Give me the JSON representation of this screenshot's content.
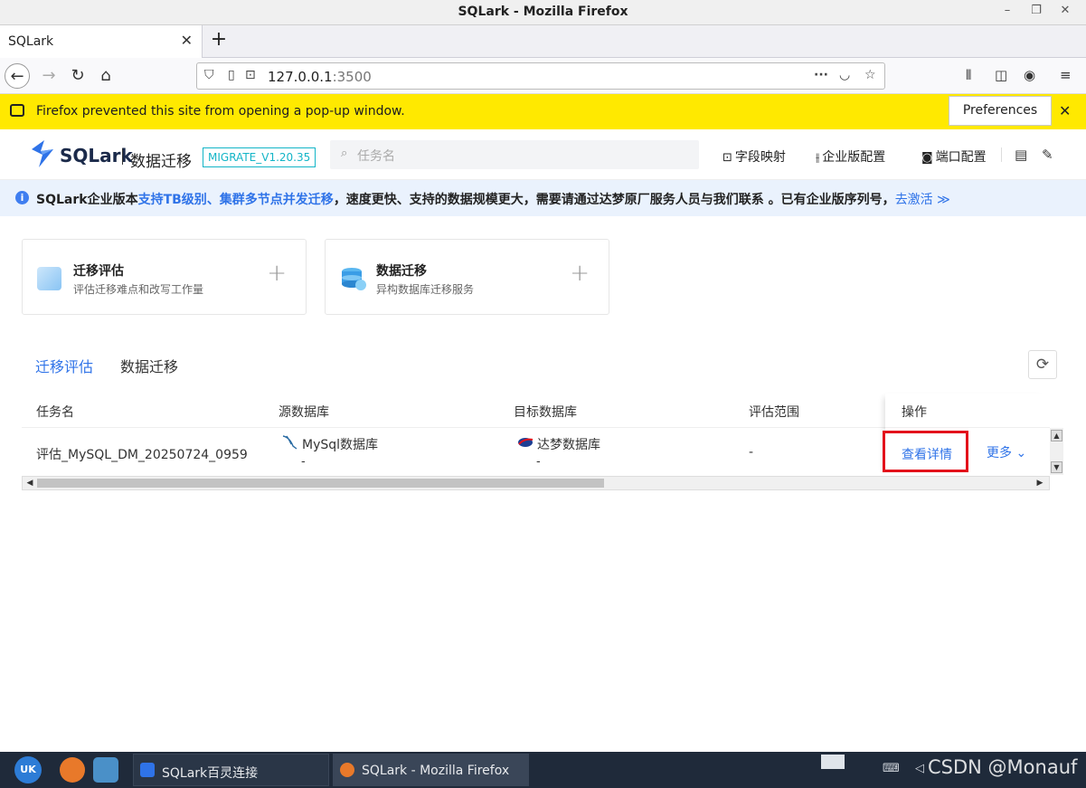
{
  "window": {
    "title": "SQLark - Mozilla Firefox"
  },
  "browser": {
    "tab_title": "SQLark",
    "url_host": "127.0.0.1",
    "url_port": ":3500",
    "popup_message": "Firefox prevented this site from opening a pop-up window.",
    "preferences_label": "Preferences"
  },
  "app": {
    "logo_text": "SQLark",
    "app_name": "数据迁移",
    "version": "MIGRATE_V1.20.35",
    "search_placeholder": "任务名",
    "header_links": [
      "字段映射",
      "企业版配置",
      "端口配置"
    ],
    "accent_color": "#2f73e8"
  },
  "banner": {
    "prefix": "SQLark企业版本",
    "highlight": "支持TB级别、集群多节点并发迁移",
    "middle": "，速度更快、支持的数据规模更大，需要请通过达梦原厂服务人员与我们联系 。已有企业版序列号，",
    "link": "去激活 ≫"
  },
  "cards": [
    {
      "title": "迁移评估",
      "desc": "评估迁移难点和改写工作量"
    },
    {
      "title": "数据迁移",
      "desc": "异构数据库迁移服务"
    }
  ],
  "list_tabs": {
    "active": "迁移评估",
    "inactive": "数据迁移"
  },
  "table": {
    "headers": [
      "任务名",
      "源数据库",
      "目标数据库",
      "评估范围",
      "操作"
    ],
    "row": {
      "task_name": "评估_MySQL_DM_20250724_0959",
      "source_db": "MySql数据库",
      "source_sub": "-",
      "target_db": "达梦数据库",
      "target_sub": "-",
      "scope": "-",
      "view_detail": "查看详情",
      "more": "更多"
    }
  },
  "taskbar": {
    "tasks": [
      "SQLark百灵连接",
      "SQLark - Mozilla Firefox"
    ],
    "watermark": "CSDN @Monauf"
  }
}
